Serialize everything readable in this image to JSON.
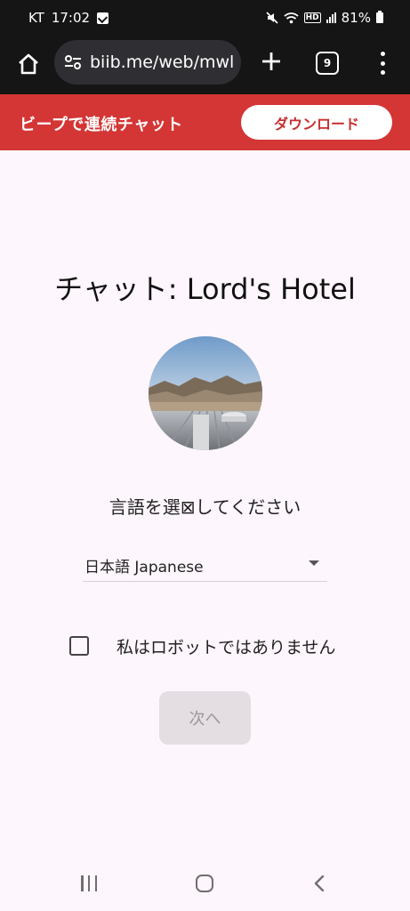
{
  "status_bar": {
    "carrier": "KT",
    "time": "17:02",
    "battery": "81%",
    "hd_label": "HD",
    "icons": [
      "notification-check-icon",
      "mute-icon",
      "wifi-icon",
      "hd-icon",
      "signal-icon",
      "battery-icon"
    ]
  },
  "browser": {
    "url": "biib.me/web/mwl",
    "tab_count": "9",
    "icons": [
      "home-icon",
      "site-settings-icon",
      "plus-icon",
      "tabs-icon",
      "more-vert-icon"
    ]
  },
  "banner": {
    "title": "ビープで連続チャット",
    "download_label": "ダウンロード",
    "color": "#d43535"
  },
  "main": {
    "chat_title": "チャット: Lord's Hotel",
    "language_prompt": "言語を選⊠してください",
    "language_value": "日本語 Japanese",
    "robot_label": "私はロボットではありません",
    "robot_checked": false,
    "next_label": "次へ",
    "next_disabled": true
  },
  "nav_bar": {
    "icons": [
      "recent-apps-icon",
      "home-nav-icon",
      "back-icon"
    ]
  }
}
